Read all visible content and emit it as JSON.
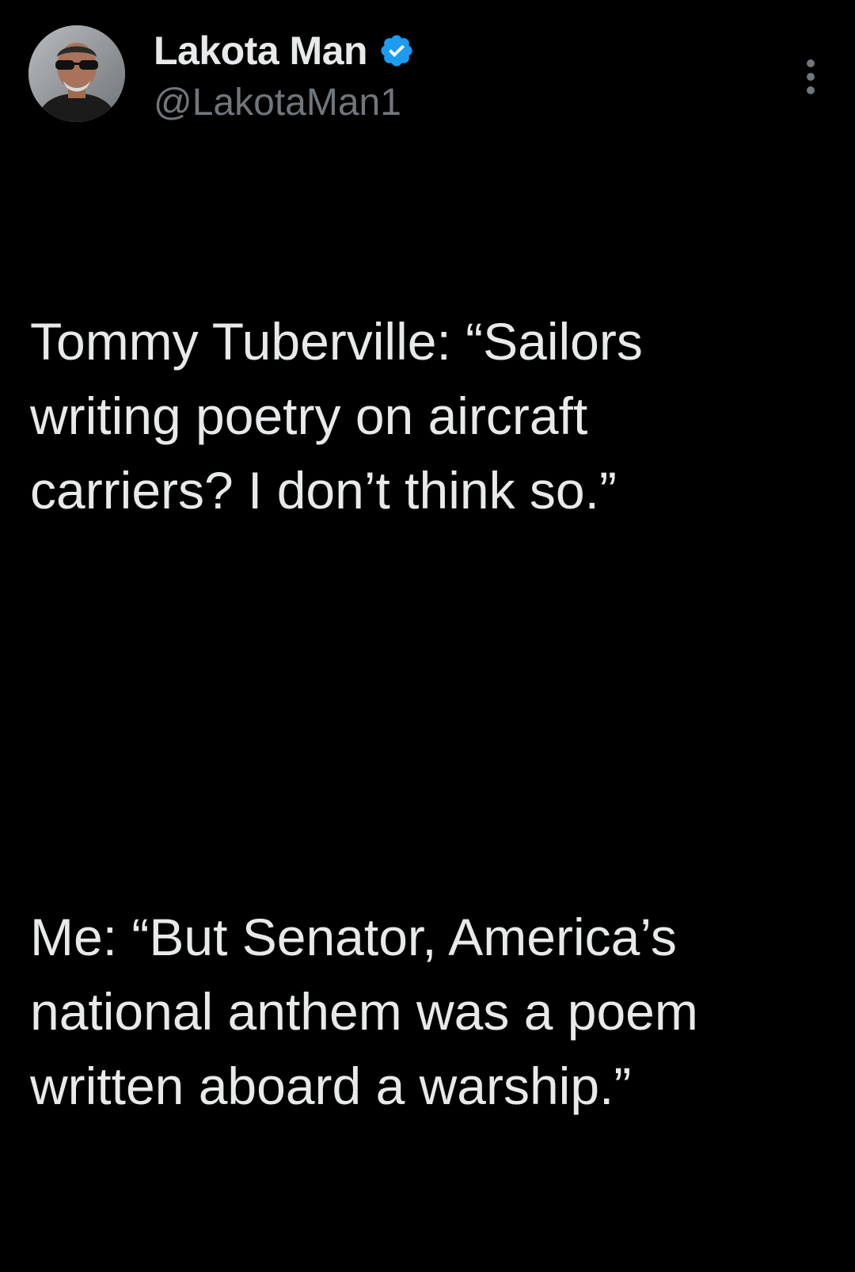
{
  "user": {
    "display_name": "Lakota Man",
    "handle": "@LakotaMan1",
    "verified": true,
    "verified_color": "#1d9bf0",
    "avatar": "profile-photo"
  },
  "tweet": {
    "paragraphs": [
      "Tommy Tuberville: “Sailors\nwriting poetry on aircraft\ncarriers? I don’t think so.”",
      "Me: “But Senator, America’s\nnational anthem was a poem\nwritten aboard a warship.”"
    ]
  },
  "menu": {
    "icon": "more-vertical-icon"
  },
  "colors": {
    "background": "#000000",
    "text": "#e7e9ea",
    "secondary": "#71767b"
  }
}
